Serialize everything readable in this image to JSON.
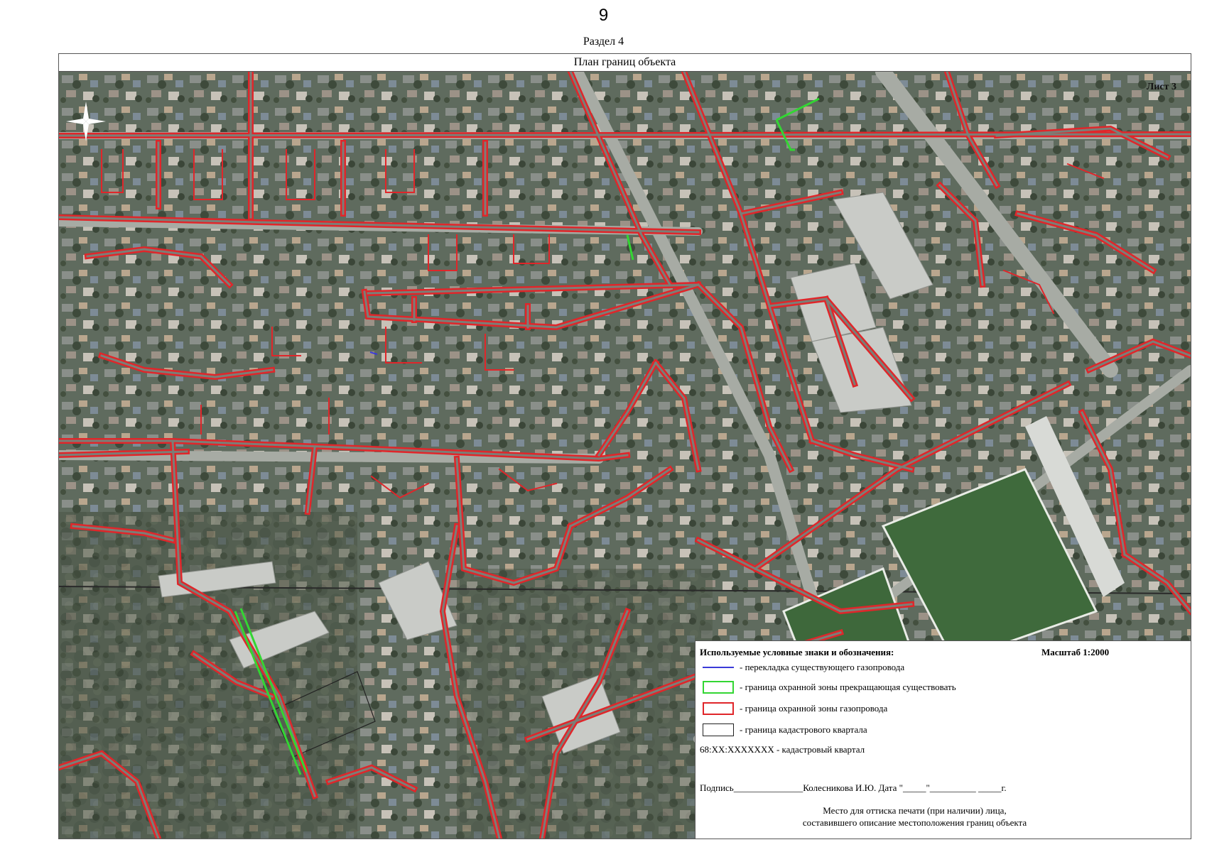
{
  "page": {
    "number": "9",
    "section": "Раздел 4",
    "plan_title": "План границ объекта"
  },
  "map": {
    "sheet_label": "Лист 3",
    "colors": {
      "protection_zone": "#e0262a",
      "terminated_zone": "#33d633",
      "relaid_pipeline": "#3a3ad8",
      "cadastral_block": "#222222"
    }
  },
  "legend": {
    "title": "Используемые условные знаки и обозначения:",
    "scale": "Масштаб 1:2000",
    "items": [
      {
        "symbol": "blue-line",
        "label": "- перекладка существующего газопровода"
      },
      {
        "symbol": "green-box",
        "label": "- граница охранной зоны прекращающая существовать"
      },
      {
        "symbol": "red-box",
        "label": "- граница охранной зоны газопровода"
      },
      {
        "symbol": "black-box",
        "label": "- граница кадастрового квартала"
      }
    ],
    "cadastral_note": "68:XX:XXXXXXX - кадастровый квартал",
    "signature": "Подпись_______________Колесникова И.Ю. Дата \"_____\"__________ _____г.",
    "stamp_line1": "Место для оттиска печати (при наличии) лица,",
    "stamp_line2": "составившего описание местоположения границ объекта"
  }
}
